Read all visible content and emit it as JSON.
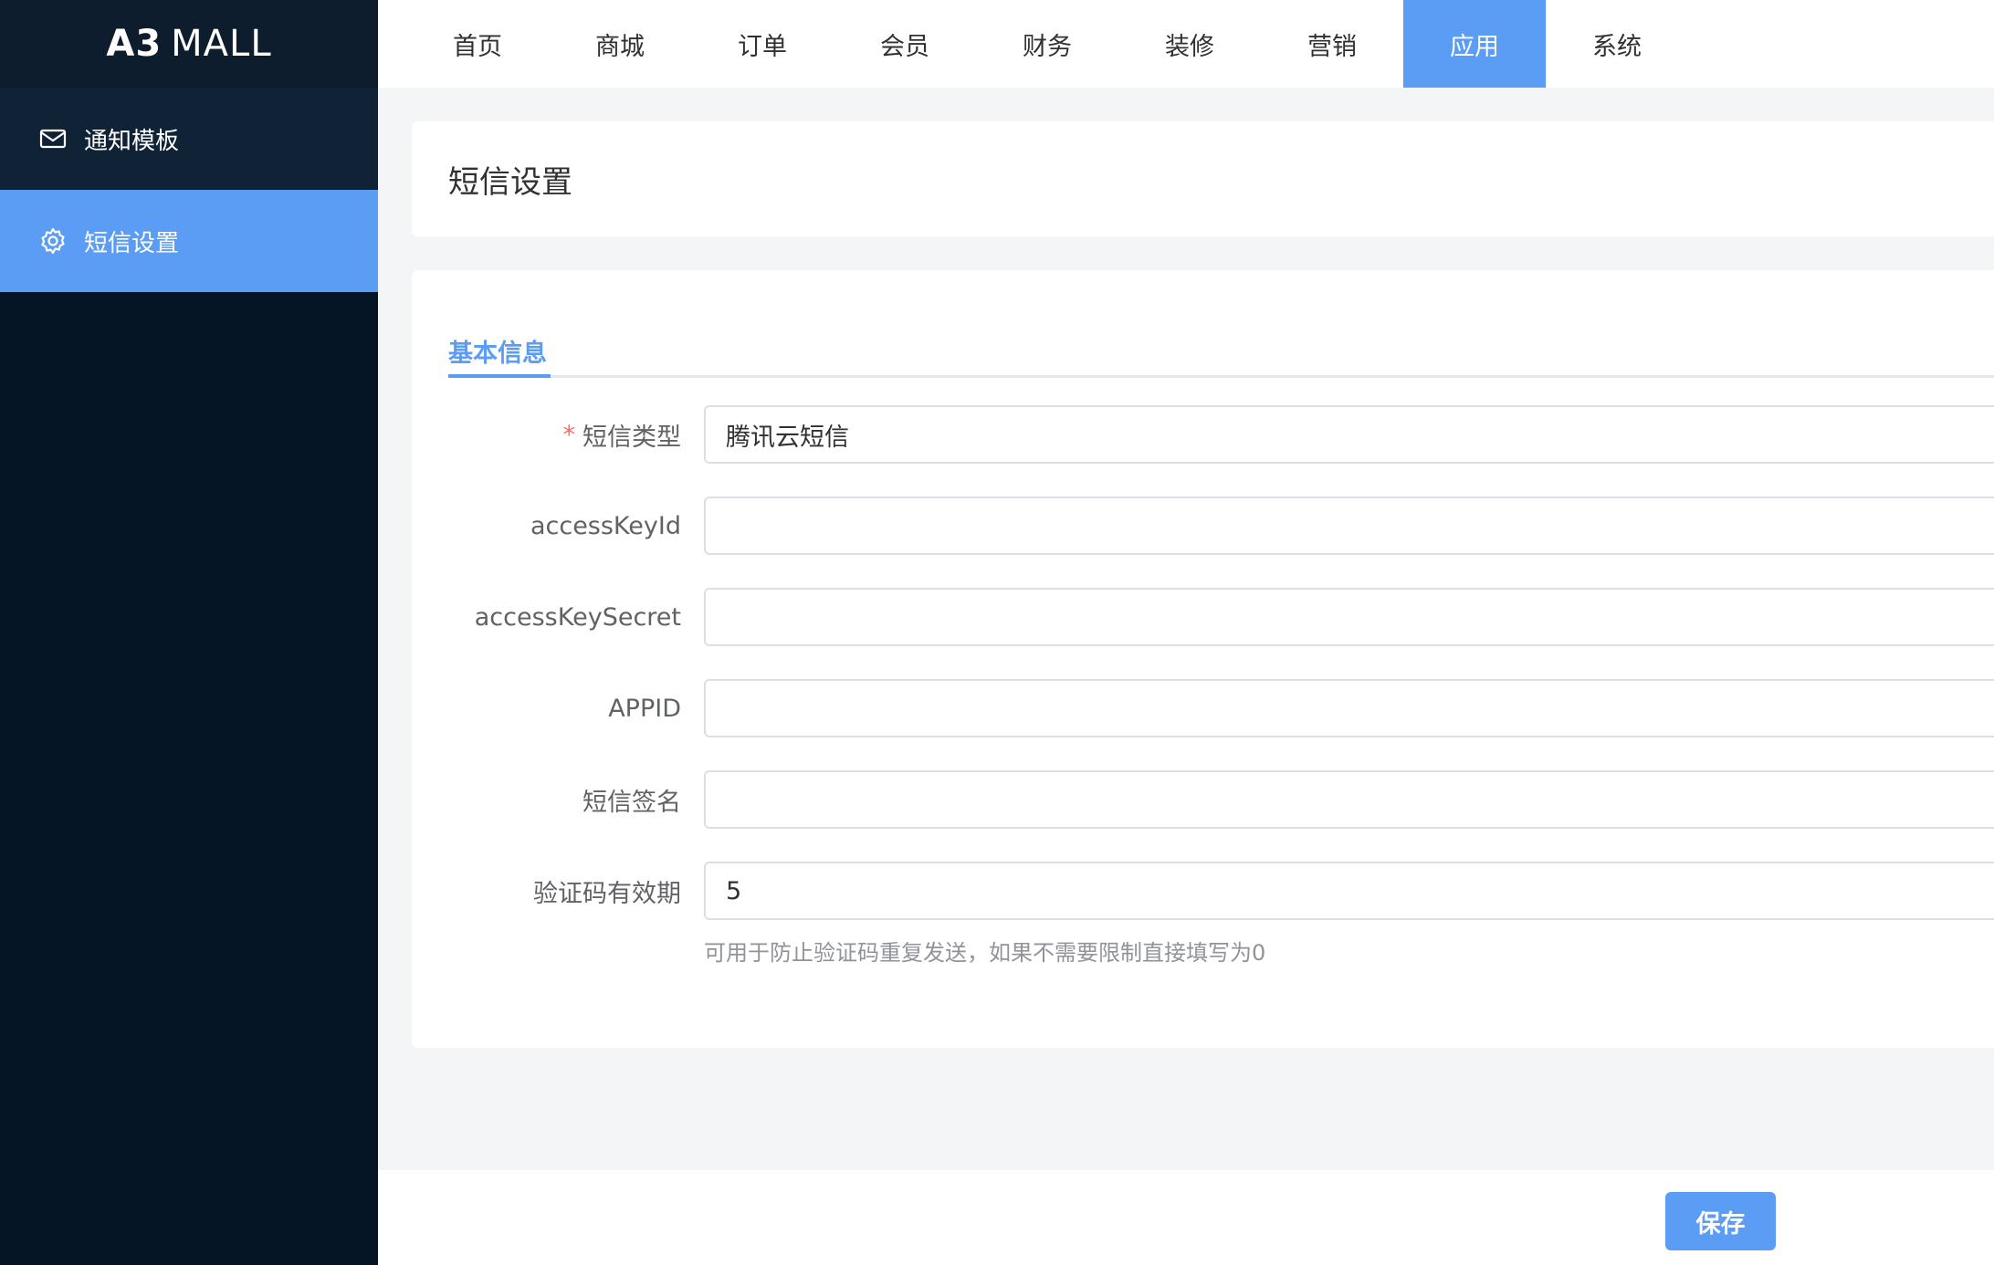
{
  "app": {
    "logo_bold": "A3",
    "logo_light": "MALL"
  },
  "sidebar": {
    "items": [
      {
        "label": "通知模板",
        "icon": "mail-icon",
        "active": false
      },
      {
        "label": "短信设置",
        "icon": "gear-icon",
        "active": true
      }
    ]
  },
  "topnav": {
    "items": [
      {
        "label": "首页"
      },
      {
        "label": "商城"
      },
      {
        "label": "订单"
      },
      {
        "label": "会员"
      },
      {
        "label": "财务"
      },
      {
        "label": "装修"
      },
      {
        "label": "营销"
      },
      {
        "label": "应用",
        "active": true
      },
      {
        "label": "系统"
      }
    ]
  },
  "page": {
    "title": "短信设置"
  },
  "form": {
    "tab_label": "基本信息",
    "fields": [
      {
        "label": "短信类型",
        "required": true,
        "value": "腾讯云短信"
      },
      {
        "label": "accessKeyId",
        "required": false,
        "value": ""
      },
      {
        "label": "accessKeySecret",
        "required": false,
        "value": ""
      },
      {
        "label": "APPID",
        "required": false,
        "value": ""
      },
      {
        "label": "短信签名",
        "required": false,
        "value": ""
      },
      {
        "label": "验证码有效期",
        "required": false,
        "value": "5"
      }
    ],
    "hint": "可用于防止验证码重复发送，如果不需要限制直接填写为0"
  },
  "footer": {
    "save_label": "保存"
  },
  "colors": {
    "accent": "#5b9cf5",
    "sidebar_bg": "#051526",
    "required": "#f56c6c"
  }
}
